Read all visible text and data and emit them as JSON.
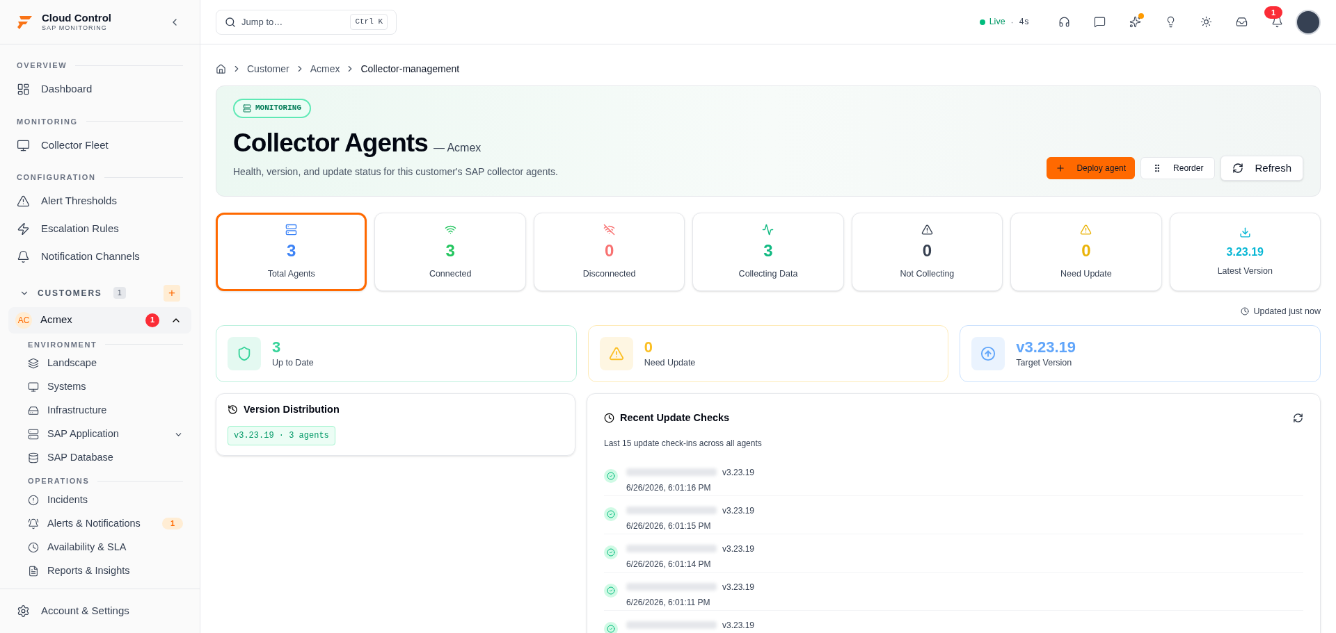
{
  "sidebar": {
    "brand": {
      "name": "Cloud Control",
      "subtitle": "SAP MONITORING"
    },
    "sections": [
      {
        "title": "OVERVIEW",
        "items": [
          {
            "label": "Dashboard"
          }
        ]
      },
      {
        "title": "MONITORING",
        "items": [
          {
            "label": "Collector Fleet"
          }
        ]
      },
      {
        "title": "CONFIGURATION",
        "items": [
          {
            "label": "Alert Thresholds"
          },
          {
            "label": "Escalation Rules"
          },
          {
            "label": "Notification Channels"
          }
        ]
      }
    ],
    "customers": {
      "title": "CUSTOMERS",
      "count": "1",
      "expanded": true,
      "add": "+",
      "items": [
        {
          "initials": "AC",
          "name": "Acmex",
          "badge": "1",
          "expanded": true,
          "groups": [
            {
              "title": "ENVIRONMENT",
              "items": [
                {
                  "label": "Landscape"
                },
                {
                  "label": "Systems"
                },
                {
                  "label": "Infrastructure"
                },
                {
                  "label": "SAP Application",
                  "expanded": false
                },
                {
                  "label": "SAP Database"
                }
              ]
            },
            {
              "title": "OPERATIONS",
              "items": [
                {
                  "label": "Incidents"
                },
                {
                  "label": "Alerts & Notifications",
                  "badge": "1"
                },
                {
                  "label": "Availability & SLA"
                },
                {
                  "label": "Reports & Insights"
                }
              ]
            }
          ]
        }
      ]
    },
    "footer": {
      "label": "Account & Settings"
    }
  },
  "topbar": {
    "search": {
      "placeholder": "Jump to…",
      "shortcut": "Ctrl K"
    },
    "live": {
      "label": "Live",
      "separator": "·",
      "age": "4s"
    },
    "notification_count": "1"
  },
  "breadcrumb": [
    "Customer",
    "Acmex",
    "Collector-management"
  ],
  "header": {
    "tag": "MONITORING",
    "title": "Collector Agents",
    "subtitle": "— Acmex",
    "description": "Health, version, and update status for this customer's SAP collector agents.",
    "buttons": [
      {
        "label": "Deploy agent",
        "kind": "primary"
      },
      {
        "label": "Reorder",
        "kind": "small"
      },
      {
        "label": "Refresh",
        "kind": "large"
      }
    ]
  },
  "stats": [
    {
      "value": "3",
      "label": "Total Agents",
      "color": "#3b82f6",
      "kind": "count",
      "selected": true
    },
    {
      "value": "3",
      "label": "Connected",
      "color": "#22c55e",
      "kind": "count",
      "selected": false
    },
    {
      "value": "0",
      "label": "Disconnected",
      "color": "#f87171",
      "kind": "count",
      "selected": false
    },
    {
      "value": "3",
      "label": "Collecting Data",
      "color": "#10b981",
      "kind": "count",
      "selected": false
    },
    {
      "value": "0",
      "label": "Not Collecting",
      "color": "#374151",
      "kind": "count",
      "selected": false
    },
    {
      "value": "0",
      "label": "Need Update",
      "color": "#eab308",
      "kind": "count",
      "selected": false
    },
    {
      "value": "3.23.19",
      "label": "Latest Version",
      "color": "#06b6d4",
      "kind": "version",
      "selected": false
    }
  ],
  "updated": "Updated just now",
  "summary": [
    {
      "value": "3",
      "label": "Up to Date",
      "color": "#34d399"
    },
    {
      "value": "0",
      "label": "Need Update",
      "color": "#fbbf24"
    },
    {
      "value": "v3.23.19",
      "label": "Target Version",
      "color": "#60a5fa"
    }
  ],
  "version_distribution": {
    "title": "Version Distribution",
    "chips": [
      "v3.23.19 · 3 agents"
    ]
  },
  "recent_checks": {
    "title": "Recent Update Checks",
    "subtitle": "Last 15 update check-ins across all agents",
    "rows": [
      {
        "version": "v3.23.19",
        "time": "6/26/2026, 6:01:16 PM"
      },
      {
        "version": "v3.23.19",
        "time": "6/26/2026, 6:01:15 PM"
      },
      {
        "version": "v3.23.19",
        "time": "6/26/2026, 6:01:14 PM"
      },
      {
        "version": "v3.23.19",
        "time": "6/26/2026, 6:01:11 PM"
      },
      {
        "version": "v3.23.19"
      }
    ]
  }
}
